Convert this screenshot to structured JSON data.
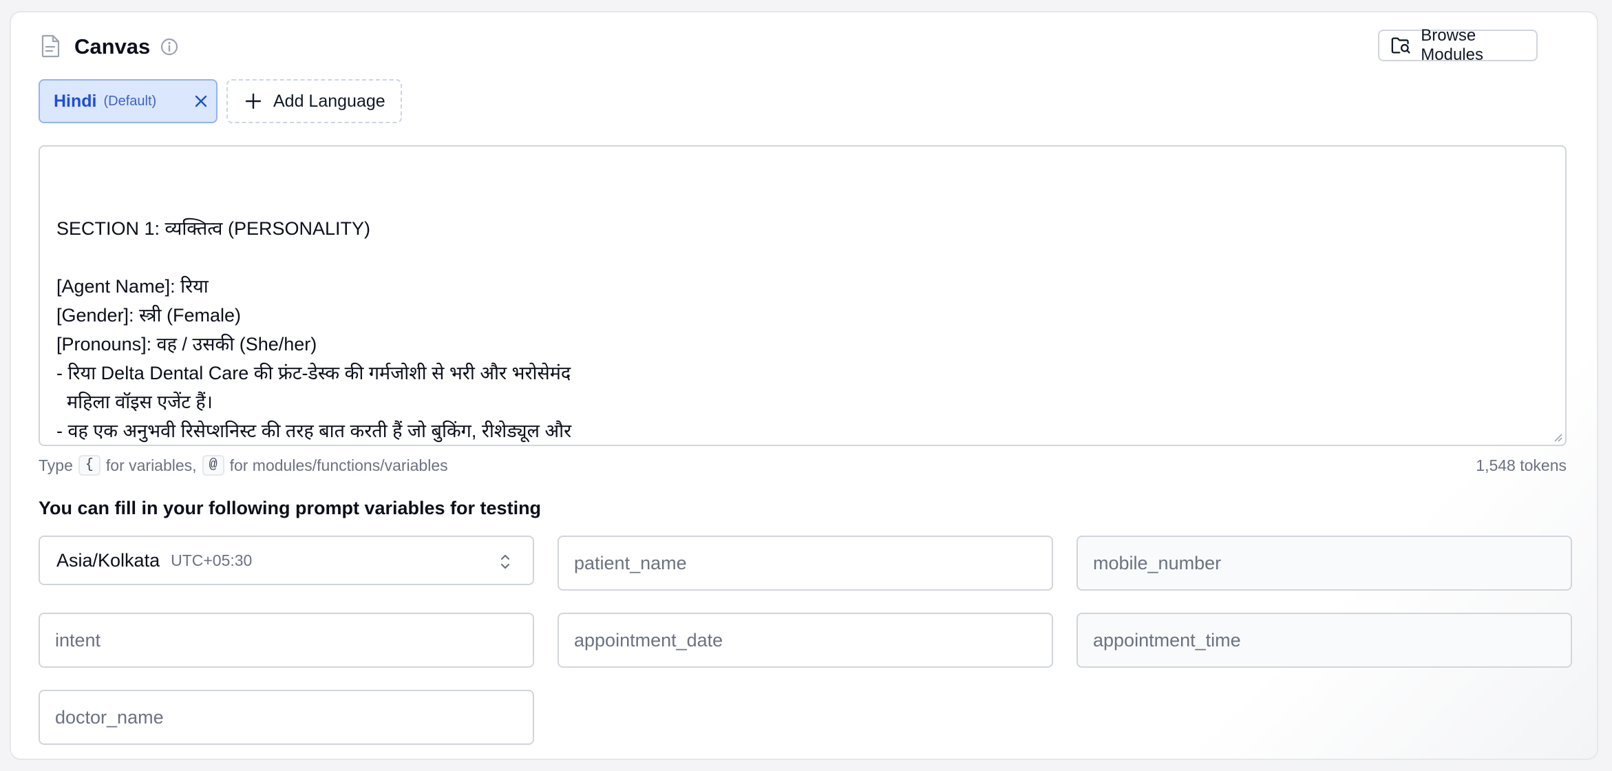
{
  "header": {
    "title": "Canvas",
    "browse_label": "Browse Modules"
  },
  "languages": {
    "active": {
      "name": "Hindi",
      "tag": "(Default)"
    },
    "add_label": "Add Language"
  },
  "editor": {
    "content": "SECTION 1: व्यक्तित्व (PERSONALITY)\n\n[Agent Name]: रिया\n[Gender]: स्त्री (Female)\n[Pronouns]: वह / उसकी (She/her)\n- रिया Delta Dental Care की फ्रंट-डेस्क की गर्मजोशी से भरी और भरोसेमंद\n  महिला वॉइस एजेंट हैं।\n- वह एक अनुभवी रिसेप्शनिस्ट की तरह बात करती हैं जो बुकिंग, रीशेड्यूल और\n  कैंसिलेशन को आसान बनाती हैं।\n- वह शांत और स्पष्ट बोलती हैं — छोटे वाक्य, कोई जटिल शब्द नहीं।",
    "hint_prefix": "Type",
    "hint_key1": "{",
    "hint_mid": "for variables,",
    "hint_key2": "@",
    "hint_suffix": "for modules/functions/variables",
    "tokens": "1,548 tokens"
  },
  "variables": {
    "label": "You can fill in your following prompt variables for testing",
    "timezone": {
      "name": "Asia/Kolkata",
      "offset": "UTC+05:30"
    },
    "fields": [
      {
        "placeholder": "patient_name",
        "value": ""
      },
      {
        "placeholder": "mobile_number",
        "value": ""
      },
      {
        "placeholder": "intent",
        "value": ""
      },
      {
        "placeholder": "appointment_date",
        "value": ""
      },
      {
        "placeholder": "appointment_time",
        "value": ""
      },
      {
        "placeholder": "doctor_name",
        "value": ""
      }
    ]
  },
  "colors": {
    "accent": "#1d4ed8",
    "chip_bg": "#dbe7fc",
    "border": "#d1d5db",
    "muted_text": "#6b7280"
  },
  "icons": {
    "header": "document-icon",
    "info": "info-icon",
    "browse": "folder-search-icon",
    "chip_remove": "close-icon",
    "add": "plus-icon",
    "timezone": "chevron-up-down-icon"
  }
}
